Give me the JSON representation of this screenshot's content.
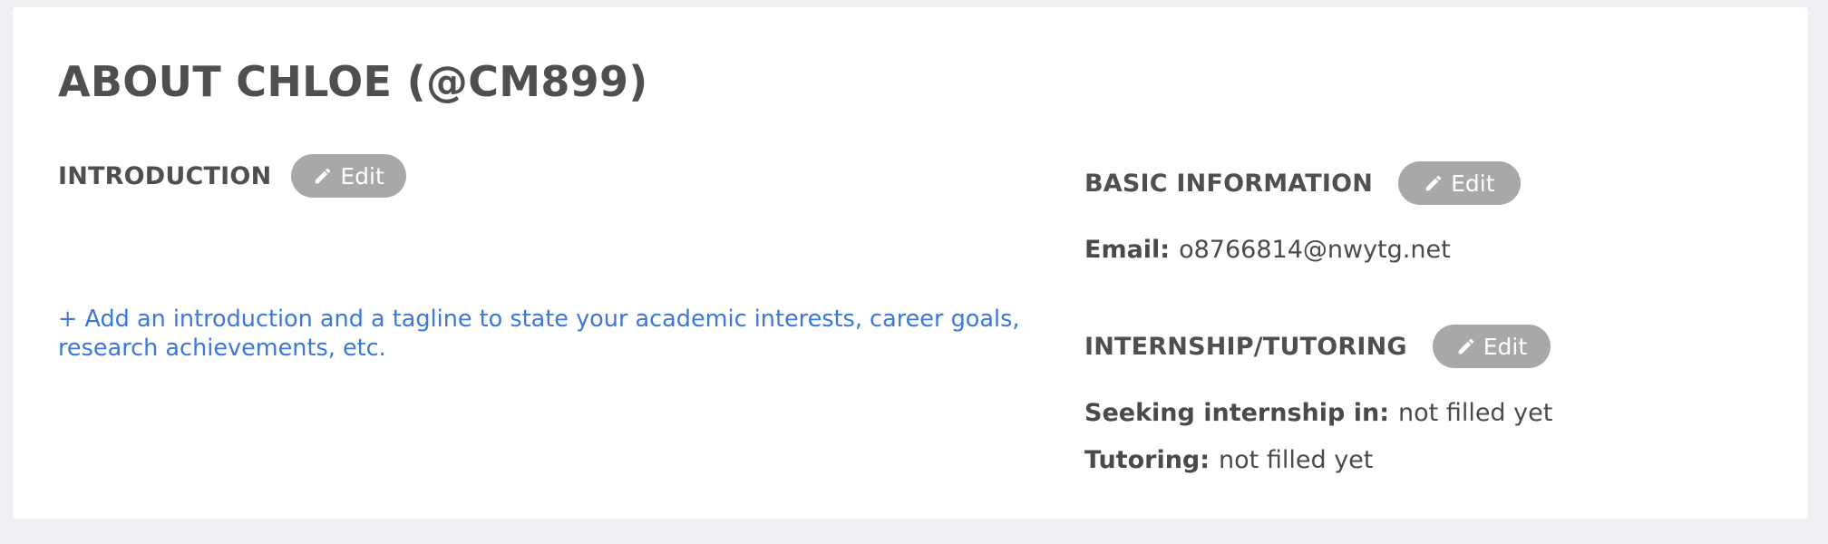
{
  "profile": {
    "title": "ABOUT CHLOE (@CM899)"
  },
  "introduction": {
    "heading": "INTRODUCTION",
    "edit_label": "Edit",
    "add_link": "+ Add an introduction and a tagline to state your academic interests, career goals, research achievements, etc."
  },
  "basic_information": {
    "heading": "BASIC INFORMATION",
    "edit_label": "Edit",
    "email_key": "Email:",
    "email_value": "o8766814@nwytg.net"
  },
  "internship_tutoring": {
    "heading": "INTERNSHIP/TUTORING",
    "edit_label": "Edit",
    "seeking_key": "Seeking internship in:",
    "seeking_value": "not filled yet",
    "tutoring_key": "Tutoring:",
    "tutoring_value": "not filled yet"
  },
  "icons": {
    "edit": "pencil-icon"
  },
  "colors": {
    "page_bg": "#eff0f4",
    "card_bg": "#ffffff",
    "heading": "#4f4f4f",
    "button_bg": "#a8a8a8",
    "link": "#3b78d8"
  }
}
